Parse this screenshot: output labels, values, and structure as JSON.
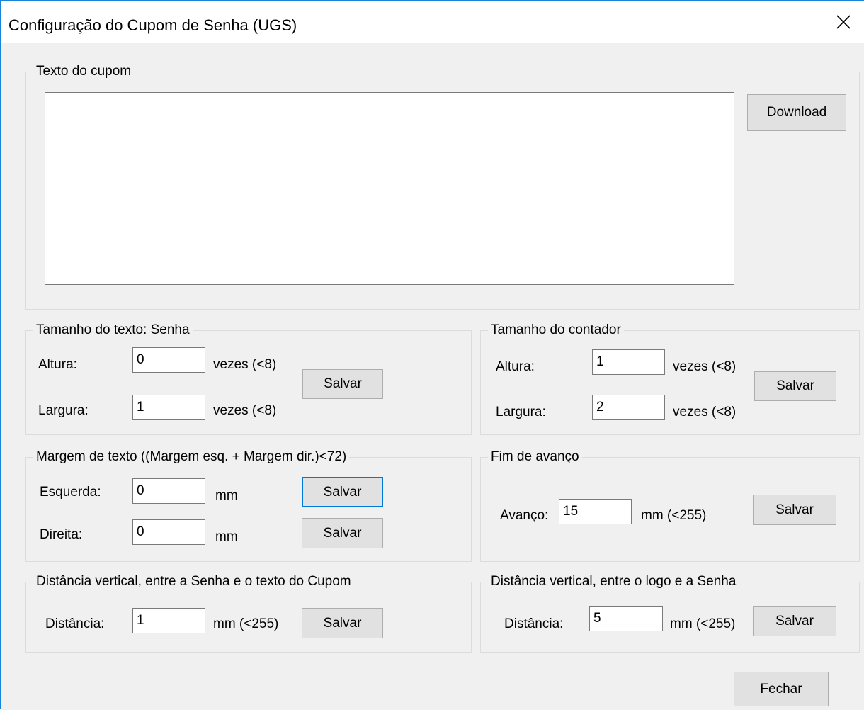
{
  "window": {
    "title": "Configuração do Cupom de Senha (UGS)",
    "close_glyph": "✕",
    "accent_color": "#1883d7"
  },
  "texto_cupom": {
    "legend": "Texto do cupom",
    "text_value": "",
    "download_label": "Download"
  },
  "tamanho_senha": {
    "legend": "Tamanho do texto: Senha",
    "altura_label": "Altura:",
    "altura_value": "0",
    "altura_suffix": "vezes (<8)",
    "largura_label": "Largura:",
    "largura_value": "1",
    "largura_suffix": "vezes (<8)",
    "save_label": "Salvar"
  },
  "tamanho_contador": {
    "legend": "Tamanho do contador",
    "altura_label": "Altura:",
    "altura_value": "1",
    "altura_suffix": "vezes (<8)",
    "largura_label": "Largura:",
    "largura_value": "2",
    "largura_suffix": "vezes (<8)",
    "save_label": "Salvar"
  },
  "margem_texto": {
    "legend": "Margem de texto ((Margem esq. + Margem dir.)<72)",
    "esquerda_label": "Esquerda:",
    "esquerda_value": "0",
    "esquerda_unit": "mm",
    "esquerda_save_label": "Salvar",
    "direita_label": "Direita:",
    "direita_value": "0",
    "direita_unit": "mm",
    "direita_save_label": "Salvar"
  },
  "fim_avanco": {
    "legend": "Fim de avanço",
    "avanco_label": "Avanço:",
    "avanco_value": "15",
    "avanco_suffix": "mm (<255)",
    "save_label": "Salvar"
  },
  "dist_senha_cupom": {
    "legend": "Distância vertical, entre a Senha e o texto do Cupom",
    "distancia_label": "Distância:",
    "distancia_value": "1",
    "distancia_suffix": "mm (<255)",
    "save_label": "Salvar"
  },
  "dist_logo_senha": {
    "legend": "Distância vertical, entre o logo e a Senha",
    "distancia_label": "Distância:",
    "distancia_value": "5",
    "distancia_suffix": "mm (<255)",
    "save_label": "Salvar"
  },
  "footer": {
    "close_label": "Fechar"
  }
}
